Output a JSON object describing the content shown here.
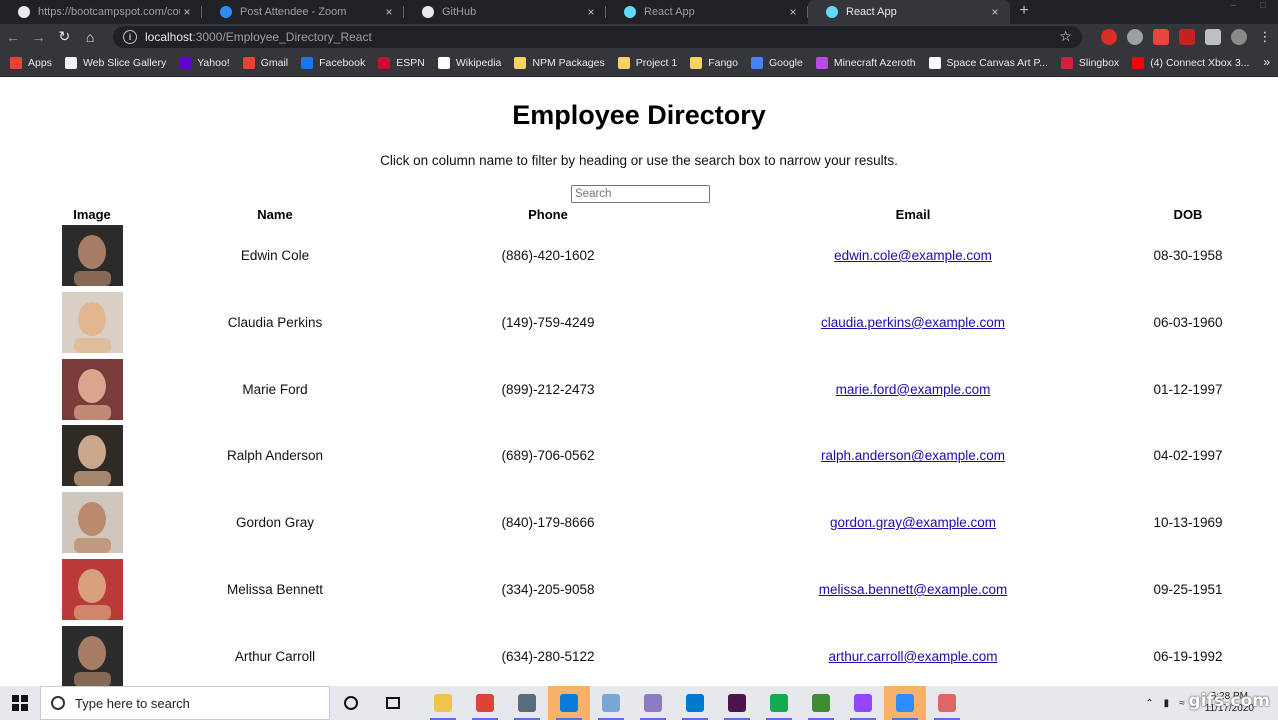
{
  "browser": {
    "tabs": [
      {
        "title": "https://bootcampspot.com/course",
        "favicon": "circle-icon",
        "color": "#e8eaed",
        "active": false
      },
      {
        "title": "Post Attendee - Zoom",
        "favicon": "zoom-icon",
        "color": "#2d8cff",
        "active": false
      },
      {
        "title": "GitHub",
        "favicon": "github-icon",
        "color": "#e8eaed",
        "active": false
      },
      {
        "title": "React App",
        "favicon": "react-icon",
        "color": "#61dafb",
        "active": false
      },
      {
        "title": "React App",
        "favicon": "react-icon",
        "color": "#61dafb",
        "active": true
      }
    ],
    "url_host": "localhost",
    "url_path": ":3000/Employee_Directory_React",
    "bookmarks": [
      {
        "label": "Apps",
        "color": "#ea4335"
      },
      {
        "label": "Web Slice Gallery",
        "color": "#f1f3f4"
      },
      {
        "label": "Yahoo!",
        "color": "#6001d2"
      },
      {
        "label": "Gmail",
        "color": "#ea4335"
      },
      {
        "label": "Facebook",
        "color": "#1877f2"
      },
      {
        "label": "ESPN",
        "color": "#c8102e"
      },
      {
        "label": "Wikipedia",
        "color": "#ffffff"
      },
      {
        "label": "NPM Packages",
        "color": "#f6d365"
      },
      {
        "label": "Project 1",
        "color": "#f6d365"
      },
      {
        "label": "Fango",
        "color": "#f6d365"
      },
      {
        "label": "Google",
        "color": "#4285f4"
      },
      {
        "label": "Minecraft Azeroth",
        "color": "#b84de0"
      },
      {
        "label": "Space Canvas Art P...",
        "color": "#ffffff"
      },
      {
        "label": "Slingbox",
        "color": "#d61f3a"
      },
      {
        "label": "(4) Connect Xbox 3...",
        "color": "#ff0000"
      }
    ]
  },
  "page": {
    "title": "Employee Directory",
    "subtitle": "Click on column name to filter by heading or use the search box to narrow your results.",
    "search_placeholder": "Search",
    "columns": {
      "image": "Image",
      "name": "Name",
      "phone": "Phone",
      "email": "Email",
      "dob": "DOB"
    },
    "employees": [
      {
        "name": "Edwin Cole",
        "phone": "(886)-420-1602",
        "email": "edwin.cole@example.com",
        "dob": "08-30-1958",
        "photo_bg": "#2b2b2b",
        "photo_fg": "#a67d65"
      },
      {
        "name": "Claudia Perkins",
        "phone": "(149)-759-4249",
        "email": "claudia.perkins@example.com",
        "dob": "06-03-1960",
        "photo_bg": "#d9cfc4",
        "photo_fg": "#e2b78e"
      },
      {
        "name": "Marie Ford",
        "phone": "(899)-212-2473",
        "email": "marie.ford@example.com",
        "dob": "01-12-1997",
        "photo_bg": "#7a3b3b",
        "photo_fg": "#d9a58c"
      },
      {
        "name": "Ralph Anderson",
        "phone": "(689)-706-0562",
        "email": "ralph.anderson@example.com",
        "dob": "04-02-1997",
        "photo_bg": "#2f2a24",
        "photo_fg": "#caa68a"
      },
      {
        "name": "Gordon Gray",
        "phone": "(840)-179-8666",
        "email": "gordon.gray@example.com",
        "dob": "10-13-1969",
        "photo_bg": "#cfc6bd",
        "photo_fg": "#b98a6c"
      },
      {
        "name": "Melissa Bennett",
        "phone": "(334)-205-9058",
        "email": "melissa.bennett@example.com",
        "dob": "09-25-1951",
        "photo_bg": "#b93a38",
        "photo_fg": "#d9a07e"
      },
      {
        "name": "Arthur Carroll",
        "phone": "(634)-280-5122",
        "email": "arthur.carroll@example.com",
        "dob": "06-19-1992",
        "photo_bg": "#2b2b2b",
        "photo_fg": "#a67d65"
      }
    ]
  },
  "taskbar": {
    "search_placeholder": "Type here to search",
    "time": "6:28 PM",
    "date": "11/17/2020",
    "apps": [
      {
        "name": "file-explorer-icon",
        "color": "#f2c14e"
      },
      {
        "name": "chrome-icon",
        "color": "#db4437"
      },
      {
        "name": "calculator-icon",
        "color": "#5a6b7b"
      },
      {
        "name": "edge-icon",
        "color": "#0a7bd6"
      },
      {
        "name": "screen-icon",
        "color": "#7aa6d6"
      },
      {
        "name": "app-icon",
        "color": "#8e7cc3"
      },
      {
        "name": "vscode-icon",
        "color": "#007acc"
      },
      {
        "name": "slack-icon",
        "color": "#4a154b"
      },
      {
        "name": "mongodb-icon",
        "color": "#13aa52"
      },
      {
        "name": "robomongo-icon",
        "color": "#3c8d2f"
      },
      {
        "name": "twitch-icon",
        "color": "#9146ff"
      },
      {
        "name": "zoom-icon",
        "color": "#2d8cff"
      },
      {
        "name": "snip-icon",
        "color": "#e06666"
      }
    ]
  },
  "watermark": "gifs.com"
}
